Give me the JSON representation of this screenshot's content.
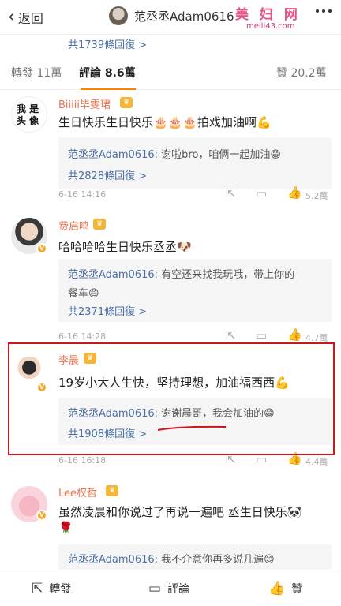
{
  "header": {
    "back_label": "返回",
    "title": "范丞丞Adam0616",
    "watermark_cn": "美 妇 网",
    "watermark_url": "meili43.com"
  },
  "top_reply_count": "共1739條回復 >",
  "tabs": [
    {
      "label": "轉發 11萬"
    },
    {
      "label": "評論 8.6萬"
    },
    {
      "label": "贊 20.2萬"
    }
  ],
  "comments": [
    {
      "author": "Biiiii毕雯珺",
      "avatar_text": "我 是\n头 像",
      "text": "生日快乐生日快乐🎂🎂🎂拍戏加油啊💪",
      "reply_author": "范丞丞Adam0616:",
      "reply_text": " 谢啦bro，咱俩一起加油😁",
      "reply_count": "共2828條回復 >",
      "time": "6-16 14:16",
      "likes": "5.2萬"
    },
    {
      "author": "费启鸣",
      "text": "哈哈哈哈生日快乐丞丞🐶",
      "reply_author": "范丞丞Adam0616:",
      "reply_text": " 有空还来找我玩哦，带上你的",
      "reply_text2": "餐车😄",
      "reply_count": "共2371條回復 >",
      "time": "6-16 14:28",
      "likes": "4.7萬"
    },
    {
      "author": "李晨",
      "text": "19岁小大人生快，坚持理想，加油福西西💪",
      "reply_author": "范丞丞Adam0616:",
      "reply_text": " 谢谢晨哥，我会加油的😁",
      "reply_count": "共1908條回復 >",
      "time": "6-16 16:18",
      "likes": "4.4萬"
    },
    {
      "author": "Lee权哲",
      "text": "虽然凌晨和你说过了再说一遍吧 丞生日快乐🐼",
      "text2": "🌹",
      "reply_author": "范丞丞Adam0616:",
      "reply_text": " 我不介意你再多说几遍😊"
    }
  ],
  "bottom_bar": {
    "repost": "轉發",
    "comment": "評論",
    "like": "贊"
  },
  "colors": {
    "accent": "#ff8200",
    "link": "#4a6fa5",
    "author": "#eb7350",
    "highlight": "#d0141b"
  }
}
